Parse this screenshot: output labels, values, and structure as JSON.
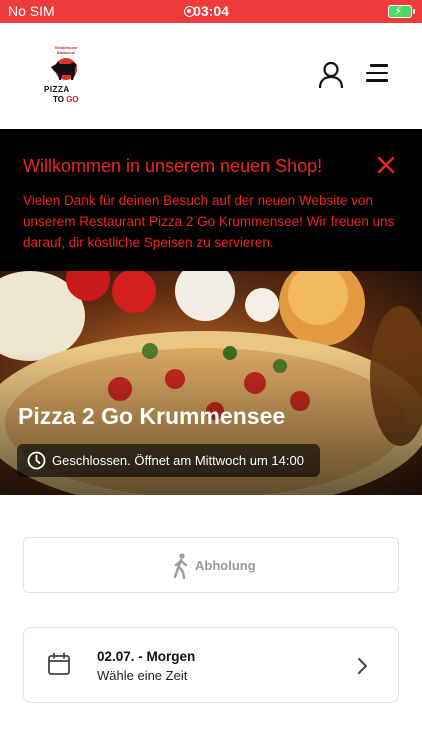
{
  "status_bar": {
    "carrier": "No SIM",
    "time": "03:04"
  },
  "header": {
    "logo": {
      "top_text": "Steakhouse Barbecue",
      "line1": "PIZZA",
      "line2_a": "TO ",
      "line2_b": "GO"
    },
    "icons": {
      "account": "user-icon",
      "menu": "hamburger-menu-icon"
    }
  },
  "banner": {
    "title": "Willkommen in unserem neuen Shop!",
    "message": "Vielen Dank für deinen Besuch auf der neuen Website von unserem Restaurant Pizza 2 Go Krummensee! Wir freuen uns darauf, dir köstliche Speisen zu servieren.",
    "close_icon": "close-icon",
    "text_color": "#ef2323"
  },
  "hero": {
    "restaurant_name": "Pizza 2 Go Krummensee",
    "status": "Geschlossen. Öffnet am Mittwoch um 14:00",
    "status_icon": "clock-icon"
  },
  "order_mode": {
    "label": "Abholung",
    "icon": "walking-person-icon"
  },
  "time_selector": {
    "date": "02.07. - Morgen",
    "hint": "Wähle eine Zeit",
    "icon": "calendar-icon",
    "arrow": "chevron-right-icon"
  },
  "colors": {
    "status_bar": "#ef3b3b",
    "accent_red": "#ef2323",
    "banner_bg": "#000000"
  }
}
